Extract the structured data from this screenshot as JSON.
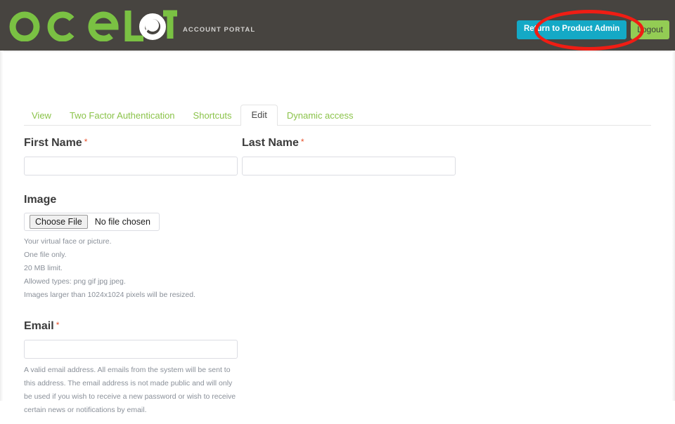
{
  "header": {
    "logo_text": "ocelot",
    "logo_letters": [
      "o",
      "c",
      "e",
      "L",
      "O",
      "T"
    ],
    "tagline": "ACCOUNT PORTAL",
    "brand_green": "#7ac143",
    "bar_color": "#474440",
    "actions": {
      "return_label": "Return to Product Admin",
      "return_color": "#14a9c6",
      "logout_label": "Logout",
      "logout_color": "#93cc54"
    },
    "annotation": {
      "shape": "ellipse",
      "color": "#f01d14",
      "target": "Return to Product Admin"
    }
  },
  "tabs": [
    {
      "label": "View",
      "active": false
    },
    {
      "label": "Two Factor Authentication",
      "active": false
    },
    {
      "label": "Shortcuts",
      "active": false
    },
    {
      "label": "Edit",
      "active": true
    },
    {
      "label": "Dynamic access",
      "active": false
    }
  ],
  "form": {
    "first_name": {
      "label": "First Name",
      "required_marker": "*",
      "value": "",
      "placeholder": ""
    },
    "last_name": {
      "label": "Last Name",
      "required_marker": "*",
      "value": "",
      "placeholder": ""
    },
    "image": {
      "label": "Image",
      "choose_button": "Choose File",
      "file_status": "No file chosen",
      "help": [
        "Your virtual face or picture.",
        "One file only.",
        "20 MB limit.",
        "Allowed types: png gif jpg jpeg.",
        "Images larger than 1024x1024 pixels will be resized."
      ]
    },
    "email": {
      "label": "Email",
      "required_marker": "*",
      "value": "",
      "placeholder": "",
      "help": "A valid email address. All emails from the system will be sent to this address. The email address is not made public and will only be used if you wish to receive a new password or wish to receive certain news or notifications by email."
    }
  }
}
